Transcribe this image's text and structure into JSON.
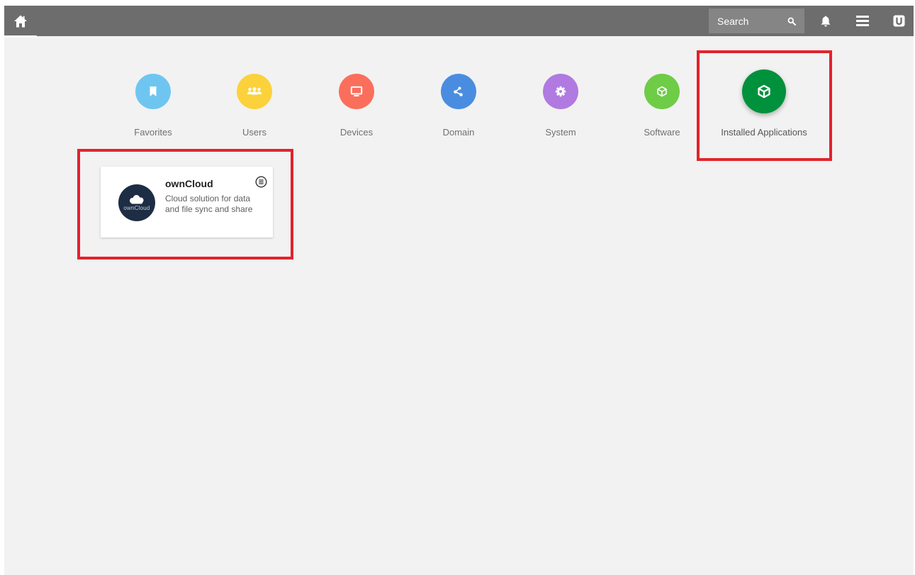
{
  "topbar": {
    "search": {
      "label": "Search"
    },
    "icons": [
      "home-icon",
      "search-icon",
      "bell-icon",
      "menu-icon",
      "univention-logo-icon"
    ]
  },
  "categories": [
    {
      "label": "Favorites",
      "color": "#6ec6f0",
      "icon": "bookmark-icon"
    },
    {
      "label": "Users",
      "color": "#fbd23b",
      "icon": "users-icon"
    },
    {
      "label": "Devices",
      "color": "#fb6e5c",
      "icon": "monitor-icon"
    },
    {
      "label": "Domain",
      "color": "#4a8de0",
      "icon": "share-icon"
    },
    {
      "label": "System",
      "color": "#b07ae0",
      "icon": "gear-icon"
    },
    {
      "label": "Software",
      "color": "#6ecc47",
      "icon": "box-icon"
    },
    {
      "label": "Installed Applications",
      "color": "#00913c",
      "icon": "box-icon",
      "selected": true
    }
  ],
  "apps": [
    {
      "name": "ownCloud",
      "description": "Cloud solution for data and file sync and share",
      "logo_text": "ownCloud",
      "logo_color": "#1d2d44"
    }
  ],
  "highlight_color": "#e3222d"
}
